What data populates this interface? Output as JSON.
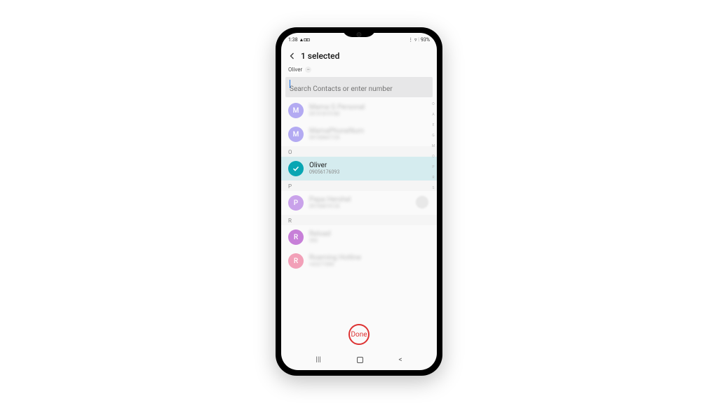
{
  "status": {
    "time": "1:38",
    "icons_left": "▲◘◘",
    "icons_right": "⋮ ▿ ⫶",
    "battery": "93%"
  },
  "header": {
    "title": "1 selected"
  },
  "chip": {
    "label": "Oliver",
    "remove_glyph": "−"
  },
  "search": {
    "placeholder": "Search Contacts or enter number",
    "value": ""
  },
  "sections": {
    "n": {
      "header": ""
    },
    "o": {
      "header": "O"
    },
    "p": {
      "header": "P"
    },
    "r": {
      "header": "R"
    }
  },
  "contacts": {
    "m1": {
      "initial": "M",
      "name": "Mama G Personal",
      "sub": "09191819180",
      "color": "#b3aaf2"
    },
    "m2": {
      "initial": "M",
      "name": "MamaPhoneNum",
      "sub": "09190847735",
      "color": "#b3aaf2"
    },
    "oliver": {
      "name": "Oliver",
      "sub": "09056176093"
    },
    "p1": {
      "initial": "P",
      "name": "Papa Hershel",
      "sub": "09190819135",
      "color": "#c9a2ea"
    },
    "r1": {
      "initial": "R",
      "name": "Reload",
      "sub": "350",
      "color": "#c77fd8"
    },
    "r2": {
      "initial": "R",
      "name": "Roaming Hotline",
      "sub": "+63271000",
      "color": "#f2a0b8"
    }
  },
  "index_letters": [
    "O",
    "A",
    "E",
    "G",
    "M",
    "O",
    "P",
    "R",
    "S"
  ],
  "done": {
    "label": "Done"
  },
  "nav": {
    "recents": "|||",
    "home": "",
    "back": "<"
  }
}
